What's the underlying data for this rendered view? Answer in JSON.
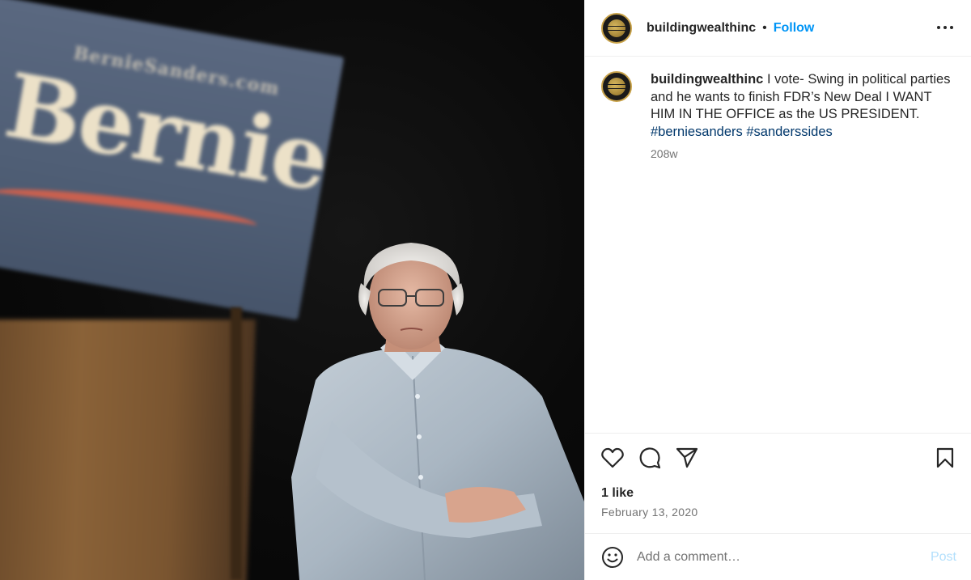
{
  "photo": {
    "sign_url": "BernieSanders.com",
    "sign_text": "Bernie"
  },
  "header": {
    "username": "buildingwealthinc",
    "separator": "•",
    "follow_label": "Follow"
  },
  "caption": {
    "username": "buildingwealthinc",
    "text": "I vote- Swing in political parties and he wants to finish FDR’s New Deal I WANT HIM IN THE OFFICE as the US PRESIDENT.",
    "hashtags": [
      "#berniesanders",
      "#sanderssides"
    ],
    "time": "208w"
  },
  "likes": "1 like",
  "date": "February 13, 2020",
  "comment": {
    "placeholder": "Add a comment…",
    "post_label": "Post"
  },
  "icons": {
    "more": "more-options-icon",
    "like": "heart-icon",
    "comment": "comment-bubble-icon",
    "share": "paper-plane-icon",
    "save": "bookmark-icon",
    "emoji": "emoji-smiley-icon"
  },
  "colors": {
    "link_blue": "#0095f6",
    "hashtag": "#00376b",
    "muted": "#737373",
    "post_disabled": "#b2dffc"
  }
}
